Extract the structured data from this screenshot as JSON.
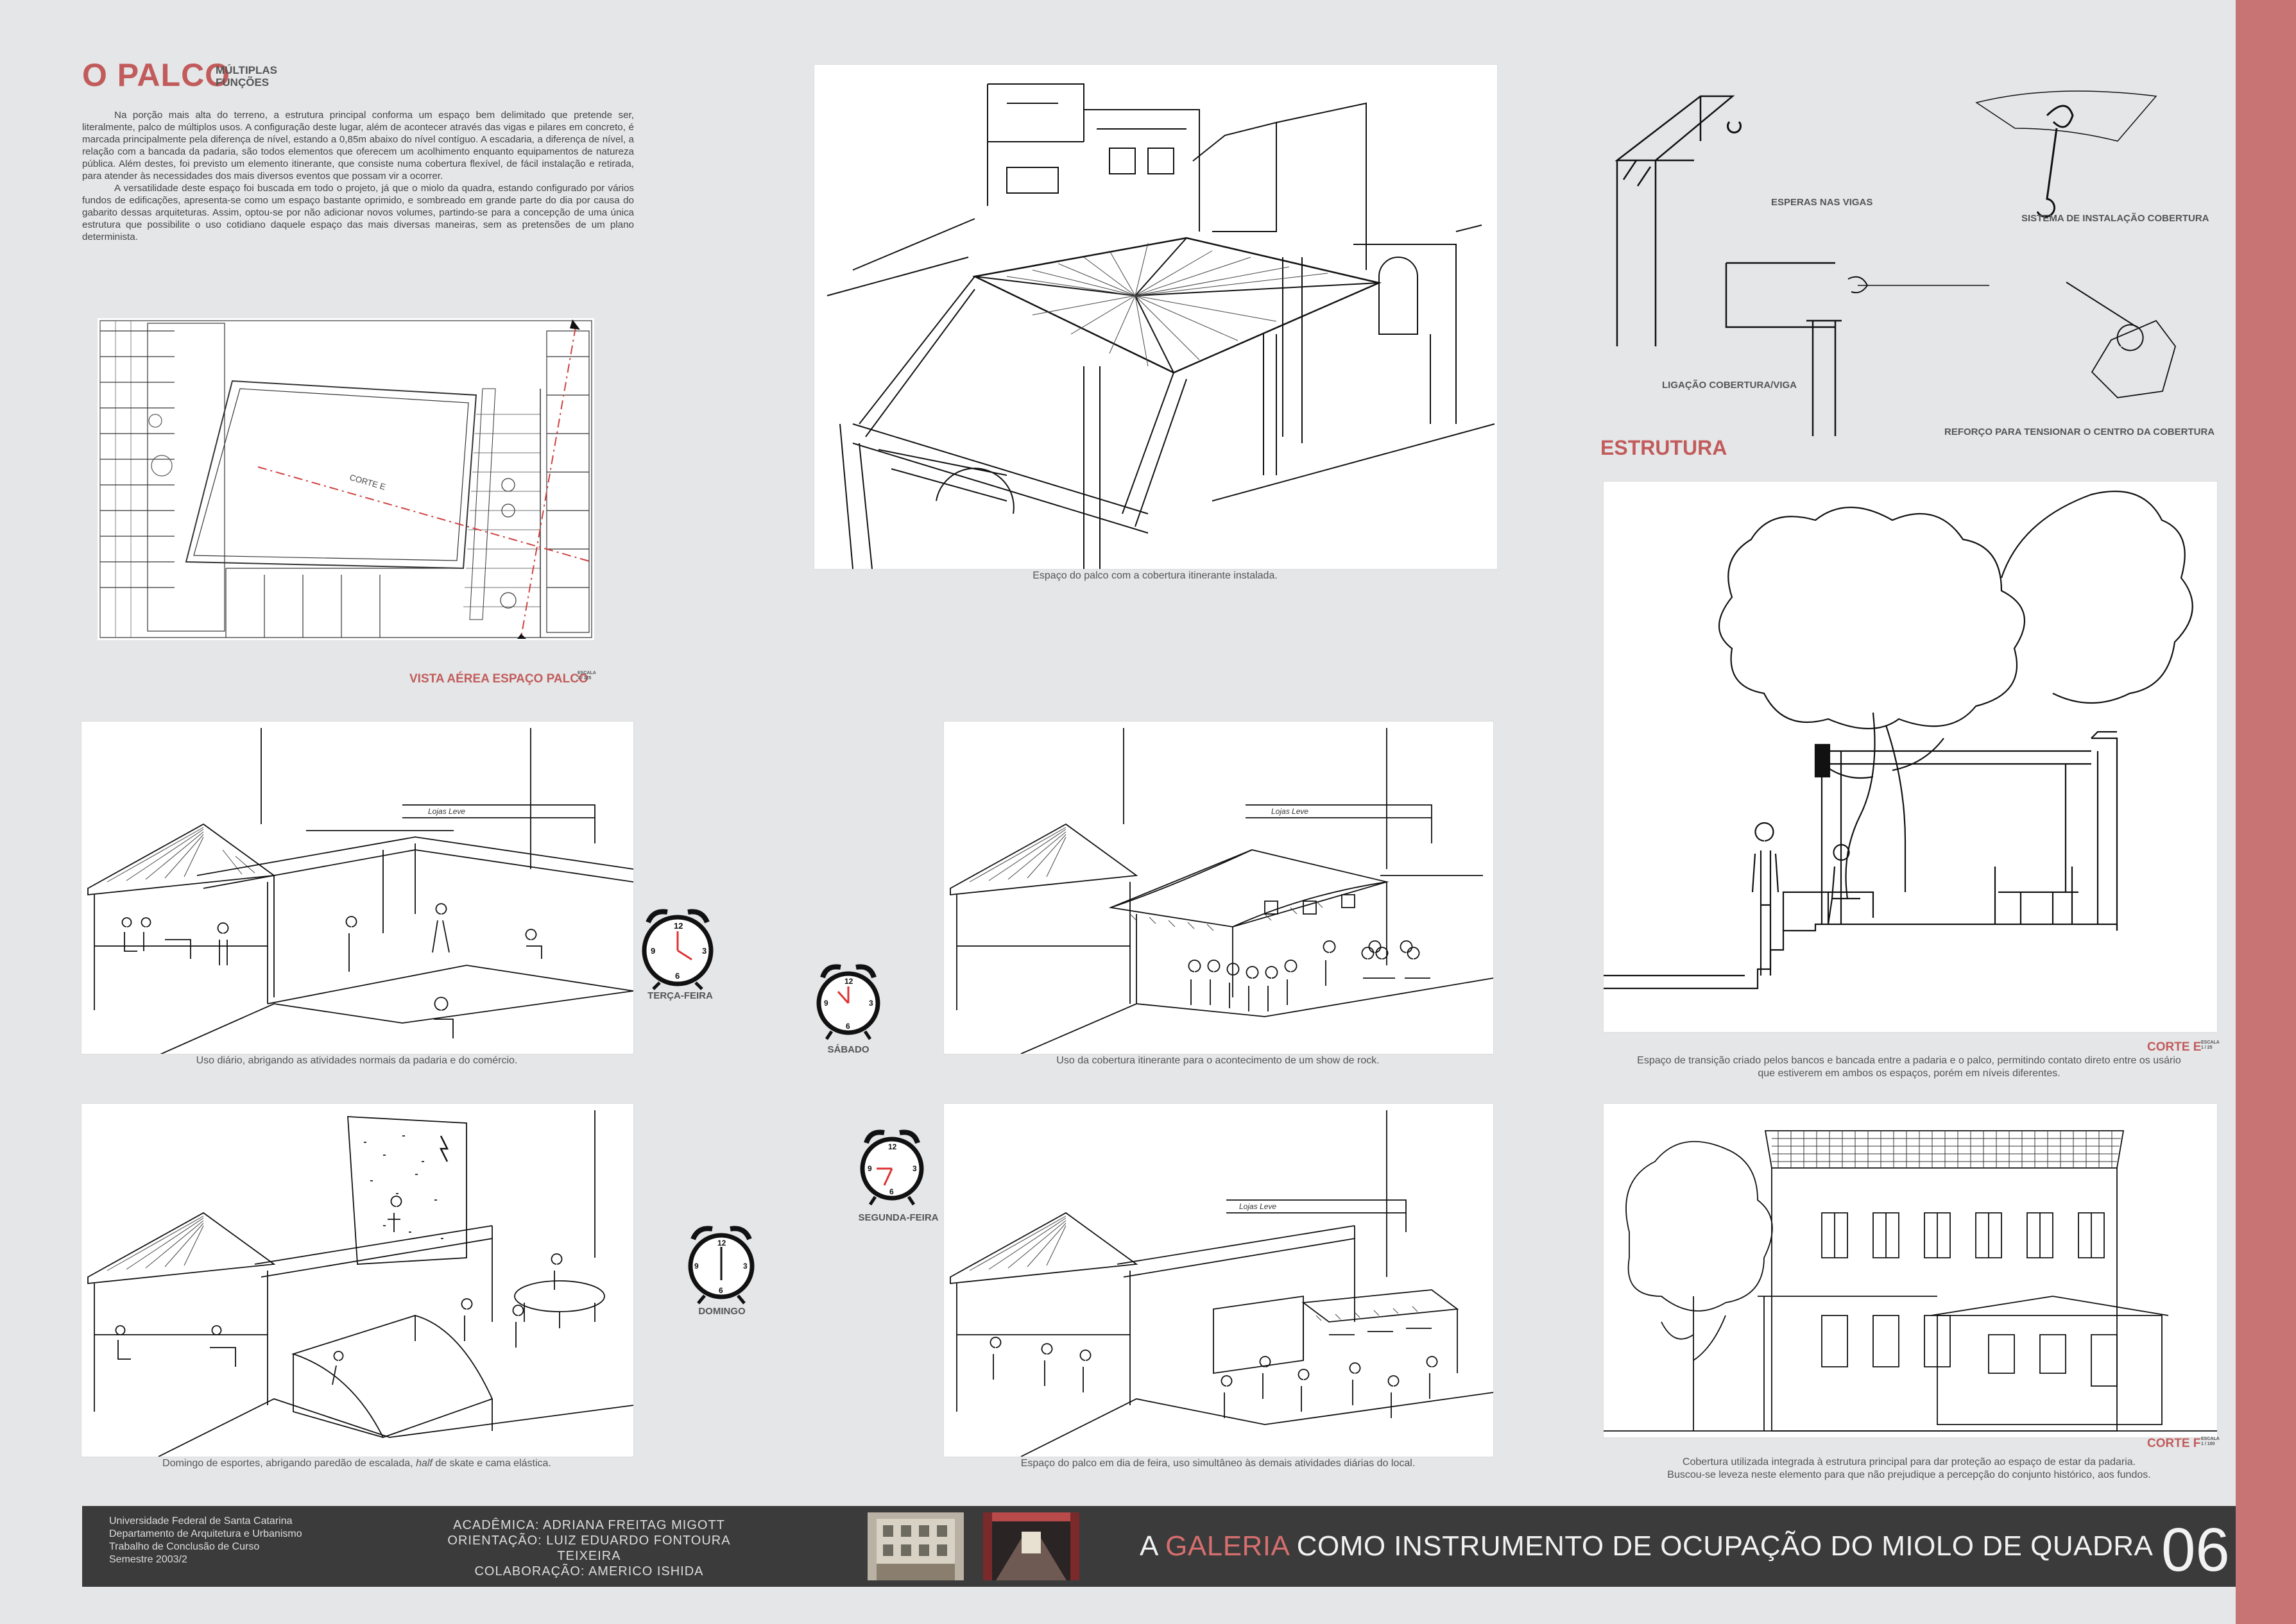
{
  "header": {
    "title": "O PALCO",
    "subtitle_line1": "MÚLTIPLAS",
    "subtitle_line2": "FUNÇÕES"
  },
  "intro": {
    "p1": "Na porção mais alta do terreno, a estrutura principal conforma um espaço bem delimitado que pretende ser, literalmente, palco de múltiplos usos. A configuração deste lugar, além de acontecer através das vigas e pilares em concreto, é marcada principalmente pela diferença de nível, estando a 0,85m abaixo do nível contíguo. A escadaria, a diferença de nível, a relação com a bancada da padaria, são todos elementos que oferecem um acolhimento enquanto equipamentos de natureza pública. Além destes, foi previsto um elemento itinerante, que consiste numa cobertura flexível, de fácil instalação e retirada, para atender às necessidades dos mais diversos eventos que possam vir a ocorrer.",
    "p2": "A versatilidade deste espaço foi buscada em todo o projeto, já que o miolo da quadra, estando configurado por vários fundos de edificações, apresenta-se como um espaço bastante oprimido, e sombreado em grande parte do dia por causa do gabarito dessas arquiteturas. Assim, optou-se por não adicionar novos volumes, partindo-se para a concepção de uma única estrutura que possibilite o uso cotidiano daquele espaço das mais diversas maneiras, sem as pretensões de um plano determinista."
  },
  "plan": {
    "label": "VISTA AÉREA ESPAÇO PALCO",
    "scale_word": "ESCALA",
    "scale_value": "1 / 125",
    "cut_label": "CORTE E"
  },
  "perspective_top": {
    "caption": "Espaço do palco com a cobertura itinerante instalada."
  },
  "estrutura": {
    "heading": "ESTRUTURA",
    "esperas": "ESPERAS NAS VIGAS",
    "sistema": "SISTEMA DE INSTALAÇÃO COBERTURA",
    "ligacao": "LIGAÇÃO COBERTURA/VIGA",
    "reforco": "REFORÇO PARA TENSIONAR O CENTRO DA COBERTURA"
  },
  "scenes": {
    "terca": {
      "caption": "Uso diário, abrigando as atividades normais da padaria e do comércio.",
      "day": "TERÇA-FEIRA"
    },
    "sabado": {
      "caption": "Uso da cobertura itinerante para o acontecimento de um show de rock.",
      "day": "SÁBADO"
    },
    "domingo": {
      "caption_a": "Domingo de esportes, abrigando paredão de escalada, ",
      "caption_em": "half",
      "caption_b": " de skate e cama elástica.",
      "day": "DOMINGO"
    },
    "segunda": {
      "caption": "Espaço do palco em dia de feira, uso simultâneo às demais atividades diárias do local.",
      "day": "SEGUNDA-FEIRA"
    },
    "sign": "Lojas Leve"
  },
  "corte_e": {
    "label": "CORTE E",
    "scale_word": "ESCALA",
    "scale_value": "1 / 25",
    "caption_1": "Espaço de transição criado pelos bancos e bancada entre a padaria e o palco, permitindo contato direto entre os usário",
    "caption_2": "que estiverem em ambos os espaços, porém em níveis diferentes."
  },
  "corte_f": {
    "label": "CORTE F",
    "scale_word": "ESCALA",
    "scale_value": "1 / 100",
    "caption_1": "Cobertura utilizada integrada à estrutura principal para dar proteção ao espaço de estar da padaria.",
    "caption_2": "Buscou-se leveza neste elemento para que não prejudique a percepção do conjunto histórico, aos fundos."
  },
  "footer": {
    "uni_1": "Universidade Federal de Santa Catarina",
    "uni_2": "Departamento de Arquitetura e Urbanismo",
    "uni_3": "Trabalho de Conclusão de Curso",
    "uni_4": "Semestre 2003/2",
    "academica": "ACADÊMICA:  ADRIANA  FREITAG  MIGOTT",
    "orientacao": "ORIENTAÇÃO:  LUIZ  EDUARDO  FONTOURA  TEIXEIRA",
    "colaboracao": "COLABORAÇÃO:  AMERICO  ISHIDA",
    "title_a": "A ",
    "title_hl": "GALERIA",
    "title_b": " COMO INSTRUMENTO DE OCUPAÇÃO DO MIOLO DE QUADRA",
    "page_number": "06"
  },
  "colors": {
    "accent": "#c25b5b",
    "right_bar": "#c87474",
    "footer_bg": "#3b3b3b",
    "page_bg": "#e4e6e7"
  }
}
